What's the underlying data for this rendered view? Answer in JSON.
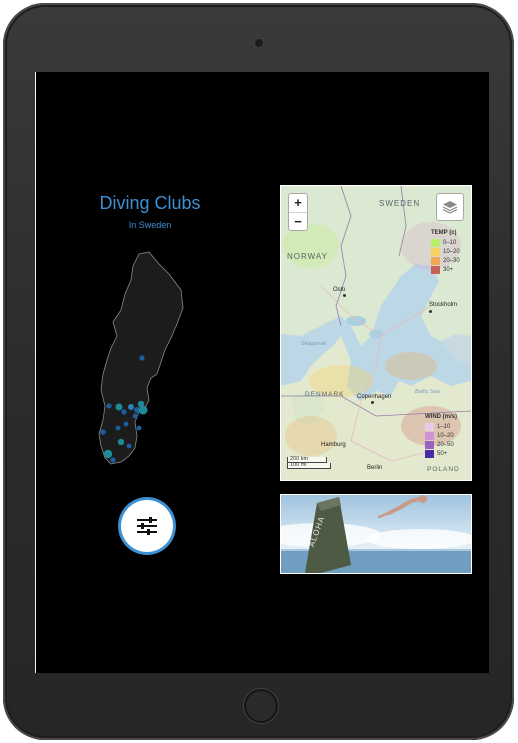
{
  "page": {
    "title": "Diving Clubs",
    "subtitle": "In Sweden"
  },
  "map": {
    "zoom_in_label": "+",
    "zoom_out_label": "−",
    "country_labels": [
      "SWEDEN",
      "NORWAY",
      "DENMARK",
      "POLAND"
    ],
    "city_labels": [
      "Oslo",
      "Stockholm",
      "Copenhagen",
      "Hamburg",
      "Berlin"
    ],
    "sea_labels": [
      "Skagerrak",
      "Baltic Sea"
    ],
    "temp_legend": {
      "title": "TEMP (c)",
      "items": [
        {
          "label": "0–10",
          "color": "#b9f06a"
        },
        {
          "label": "10–20",
          "color": "#f6d061"
        },
        {
          "label": "20–30",
          "color": "#f0a850"
        },
        {
          "label": "30+",
          "color": "#c9605a"
        }
      ]
    },
    "wind_legend": {
      "title": "WIND (m/s)",
      "items": [
        {
          "label": "1–10",
          "color": "#e8cbe6"
        },
        {
          "label": "10–20",
          "color": "#cf93d6"
        },
        {
          "label": "20–50",
          "color": "#9a62c4"
        },
        {
          "label": "50+",
          "color": "#4a2aa8"
        }
      ]
    },
    "scale_km": "200 km",
    "scale_mi": "100 mi"
  },
  "photo": {
    "caption": "ALOHA"
  },
  "colors": {
    "accent": "#3f8fd2",
    "dot": "#1f8a9a"
  }
}
